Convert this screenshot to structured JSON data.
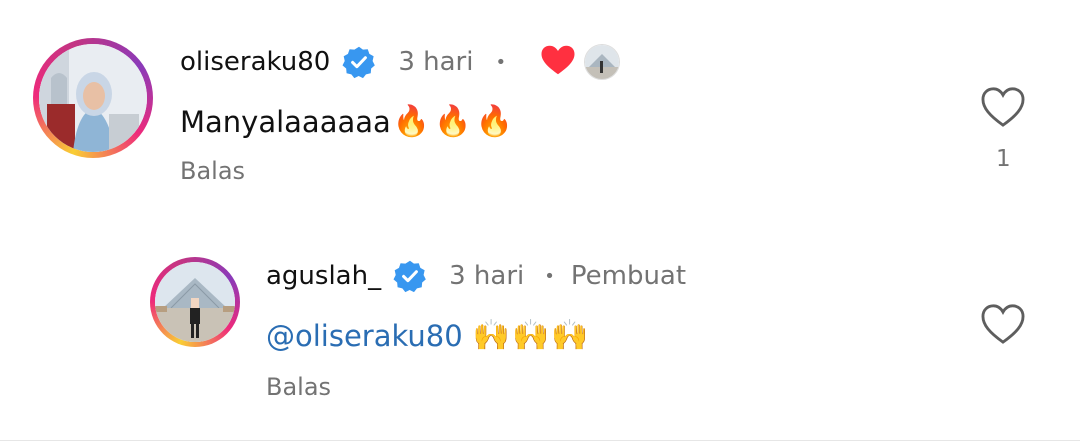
{
  "comment": {
    "username": "oliseraku80",
    "time": "3 hari",
    "dot": "•",
    "text": "Manyalaaaaaa",
    "emojis": "🔥🔥🔥",
    "reply_label": "Balas",
    "like_count": "1"
  },
  "reply": {
    "username": "aguslah_",
    "time": "3 hari",
    "dot": "•",
    "author_badge": "Pembuat",
    "mention": "@oliseraku80",
    "emojis": "🙌🙌🙌",
    "reply_label": "Balas"
  },
  "colors": {
    "verified": "#3897f0",
    "liked_heart": "#ff3040",
    "mention": "#2a6db3",
    "meta_text": "#737373"
  },
  "icons": {
    "verified": "verified-badge-icon",
    "liked_by_author": "red-heart-icon",
    "like": "heart-outline-icon"
  }
}
